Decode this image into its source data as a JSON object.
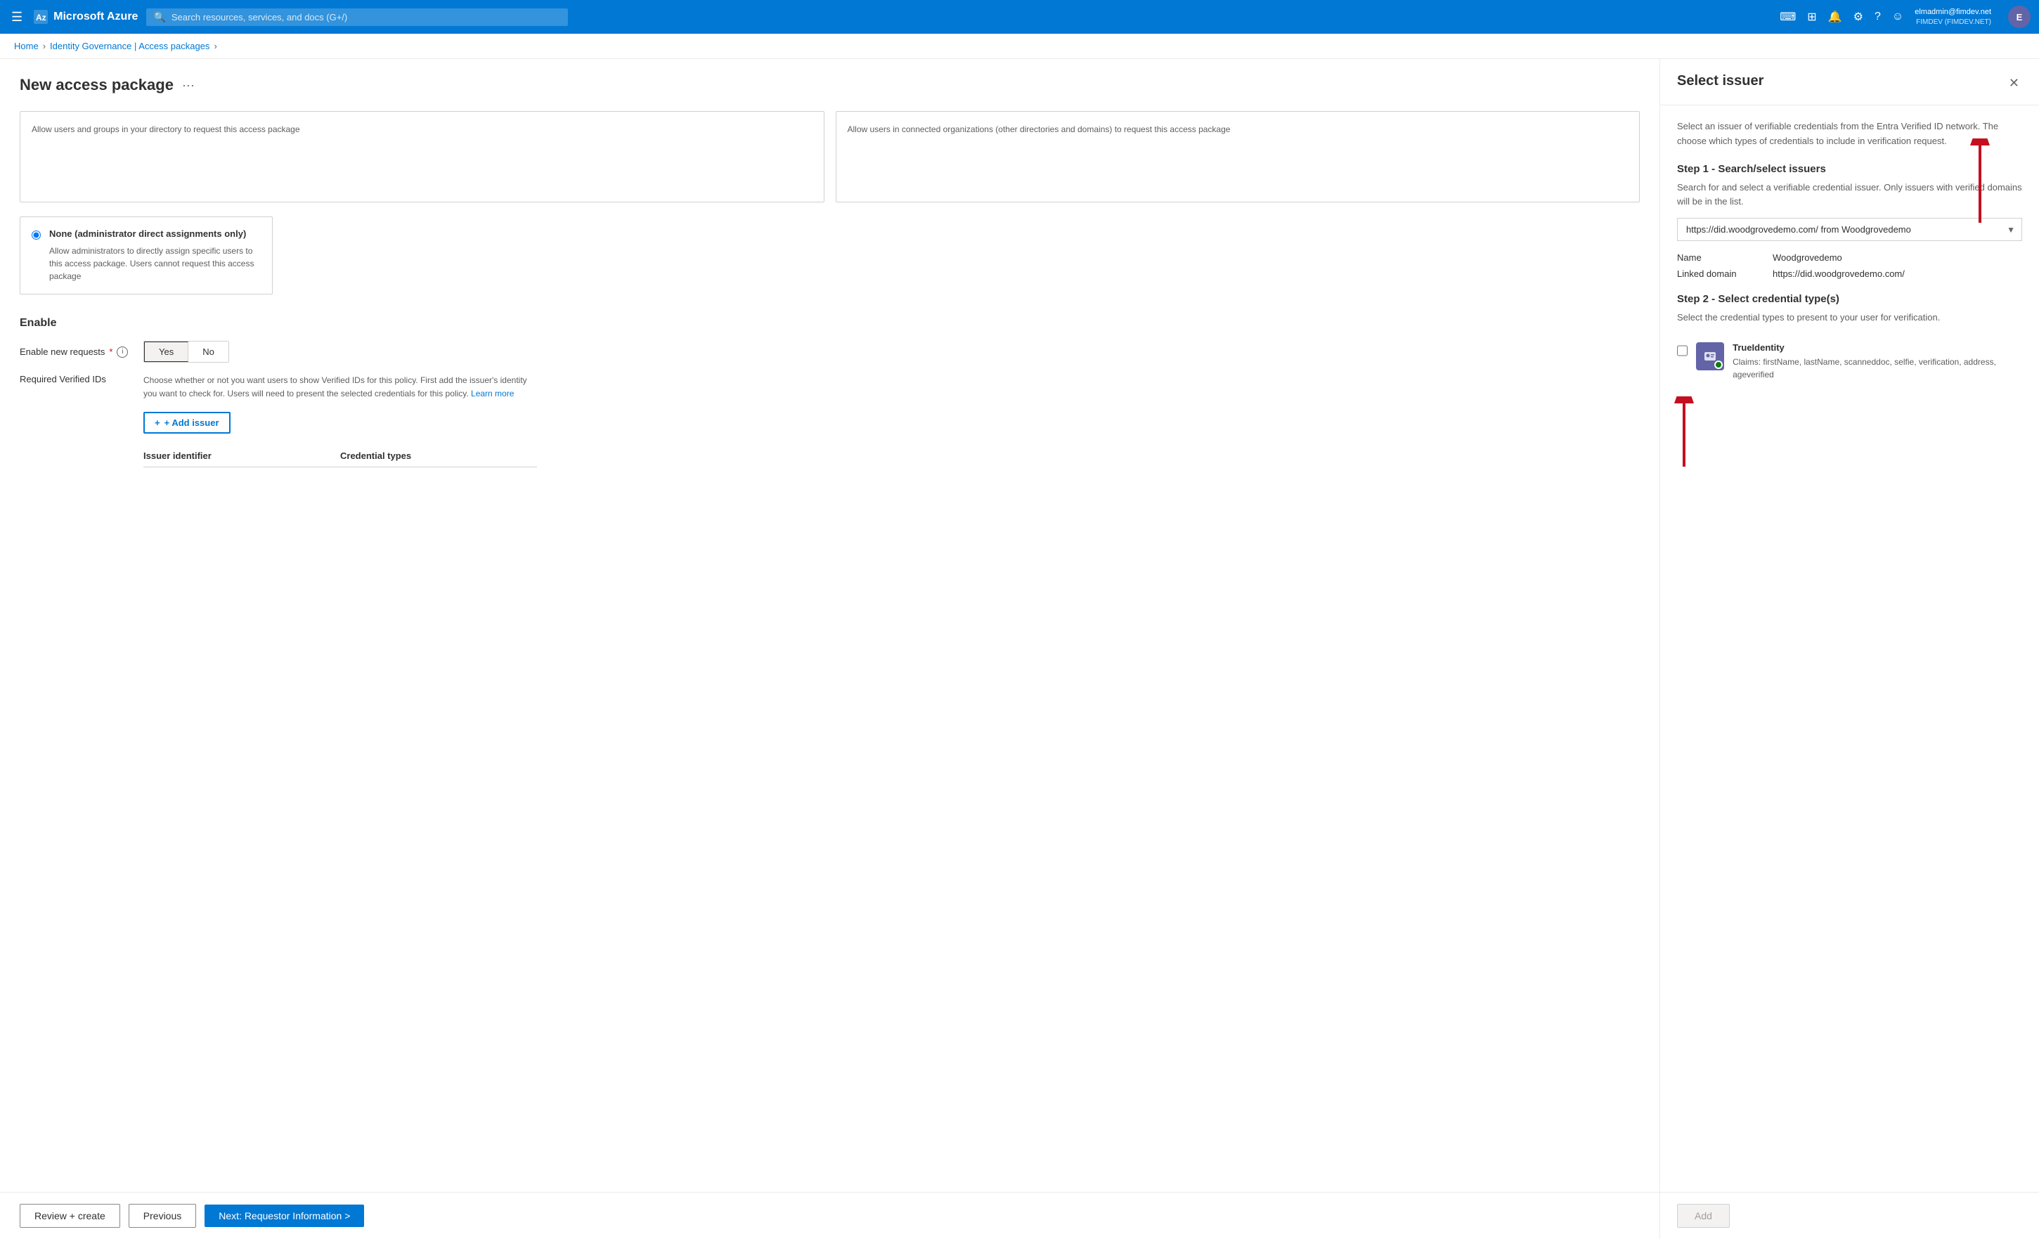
{
  "topnav": {
    "hamburger": "☰",
    "logo": "Microsoft Azure",
    "search_placeholder": "Search resources, services, and docs (G+/)",
    "user_name": "elmadmin@fimdev.net",
    "user_tenant": "FIMDEV (FIMDEV.NET)",
    "user_initials": "E"
  },
  "breadcrumb": {
    "home": "Home",
    "governance": "Identity Governance | Access packages"
  },
  "page": {
    "title": "New access package",
    "more_icon": "···"
  },
  "cards": [
    {
      "title": "",
      "desc": "Allow users and groups in your directory to request this access package"
    },
    {
      "title": "",
      "desc": "Allow users in connected organizations (other directories and domains) to request this access package"
    }
  ],
  "admin_card": {
    "title": "None (administrator direct assignments only)",
    "desc": "Allow administrators to directly assign specific users to this access package. Users cannot request this access package"
  },
  "enable_section": {
    "title": "Enable",
    "enable_requests_label": "Enable new requests",
    "yes_label": "Yes",
    "no_label": "No",
    "verified_ids_label": "Required Verified IDs",
    "verified_ids_desc": "Choose whether or not you want users to show Verified IDs for this policy. First add the issuer's identity you want to check for. Users will need to present the selected credentials for this policy.",
    "learn_more": "Learn more",
    "add_issuer_label": "+ Add issuer",
    "table_col1": "Issuer identifier",
    "table_col2": "Credential types"
  },
  "bottom_bar": {
    "review_create": "Review + create",
    "previous": "Previous",
    "next": "Next: Requestor Information >"
  },
  "flyout": {
    "title": "Select issuer",
    "close": "✕",
    "desc": "Select an issuer of verifiable credentials from the Entra Verified ID network. The choose which types of credentials to include in verification request.",
    "step1_title": "Step 1 - Search/select issuers",
    "step1_desc": "Search for and select a verifiable credential issuer. Only issuers with verified domains will be in the list.",
    "dropdown_value": "https://did.woodgrovedemo.com/  from  Woodgrovedemo",
    "name_label": "Name",
    "name_value": "Woodgrovedemo",
    "domain_label": "Linked domain",
    "domain_value": "https://did.woodgrovedemo.com/",
    "step2_title": "Step 2 - Select credential type(s)",
    "step2_desc": "Select the credential types to present to your user for verification.",
    "credential_name": "TrueIdentity",
    "credential_claims": "Claims: firstName, lastName, scanneddoc, selfie, verification, address, ageverified",
    "add_btn": "Add"
  }
}
